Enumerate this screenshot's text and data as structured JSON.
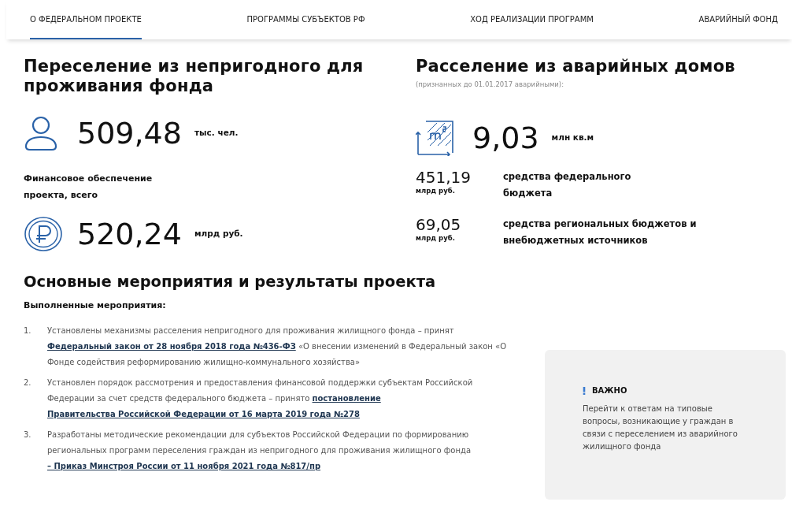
{
  "tabs": [
    {
      "label": "О ФЕДЕРАЛЬНОМ ПРОЕКТЕ",
      "selected": true
    },
    {
      "label": "ПРОГРАММЫ СУБЪЕКТОВ РФ",
      "selected": false
    },
    {
      "label": "ХОД РЕАЛИЗАЦИИ ПРОГРАММ",
      "selected": false
    },
    {
      "label": "АВАРИЙНЫЙ ФОНД",
      "selected": false
    }
  ],
  "resettlement": {
    "title": "Переселение из непригодного для проживания фонда",
    "people": {
      "value": "509,48",
      "unit": "тыс. чел."
    },
    "funding_label": "Финансовое обеспечение проекта, всего",
    "funding": {
      "value": "520,24",
      "unit": "млрд руб."
    }
  },
  "emergency": {
    "title": "Расселение из аварийных домов",
    "subtitle": "(признанных до 01.01.2017 аварийными):",
    "area": {
      "value": "9,03",
      "unit": "млн кв.м"
    },
    "sources": [
      {
        "value": "451,19",
        "unit": "млрд руб.",
        "label": "средства федерального бюджета"
      },
      {
        "value": "69,05",
        "unit": "млрд руб.",
        "label": "средства региональных бюджетов и внебюджетных источников"
      }
    ]
  },
  "results": {
    "title": "Основные мероприятия и результаты проекта",
    "subtitle": "Выполненные мероприятия:",
    "items": [
      {
        "number": "1.",
        "parts": [
          {
            "kind": "text",
            "text": "Установлены механизмы расселения непригодного для проживания жилищного фонда – принят "
          },
          {
            "kind": "link",
            "text": "Федеральный закон от 28 ноября 2018 года №436-ФЗ"
          },
          {
            "kind": "text",
            "text": " «О внесении изменений в Федеральный закон «О Фонде содействия реформированию жилищно-коммунального хозяйства»"
          }
        ]
      },
      {
        "number": "2.",
        "parts": [
          {
            "kind": "text",
            "text": "Установлен порядок рассмотрения и предоставления финансовой поддержки субъектам Российской Федерации за счет средств федерального бюджета – принято "
          },
          {
            "kind": "link",
            "text": "постановление"
          },
          {
            "kind": "break"
          },
          {
            "kind": "link",
            "text": "Правительства Российской Федерации от 16 марта 2019 года №278"
          }
        ]
      },
      {
        "number": "3.",
        "parts": [
          {
            "kind": "text",
            "text": "Разработаны методические рекомендации для субъектов Российской Федерации по формированию региональных программ переселения граждан из непригодного для проживания жилищного фонда "
          },
          {
            "kind": "link",
            "text": "– Приказ Минстроя России от 11 ноября 2021 года №817/пр"
          }
        ]
      }
    ]
  },
  "notice": {
    "title": "ВАЖНО",
    "text": "Перейти к ответам на типовые вопросы, возникающие у граждан в связи с переселением из аварийного жилищного фонда"
  }
}
